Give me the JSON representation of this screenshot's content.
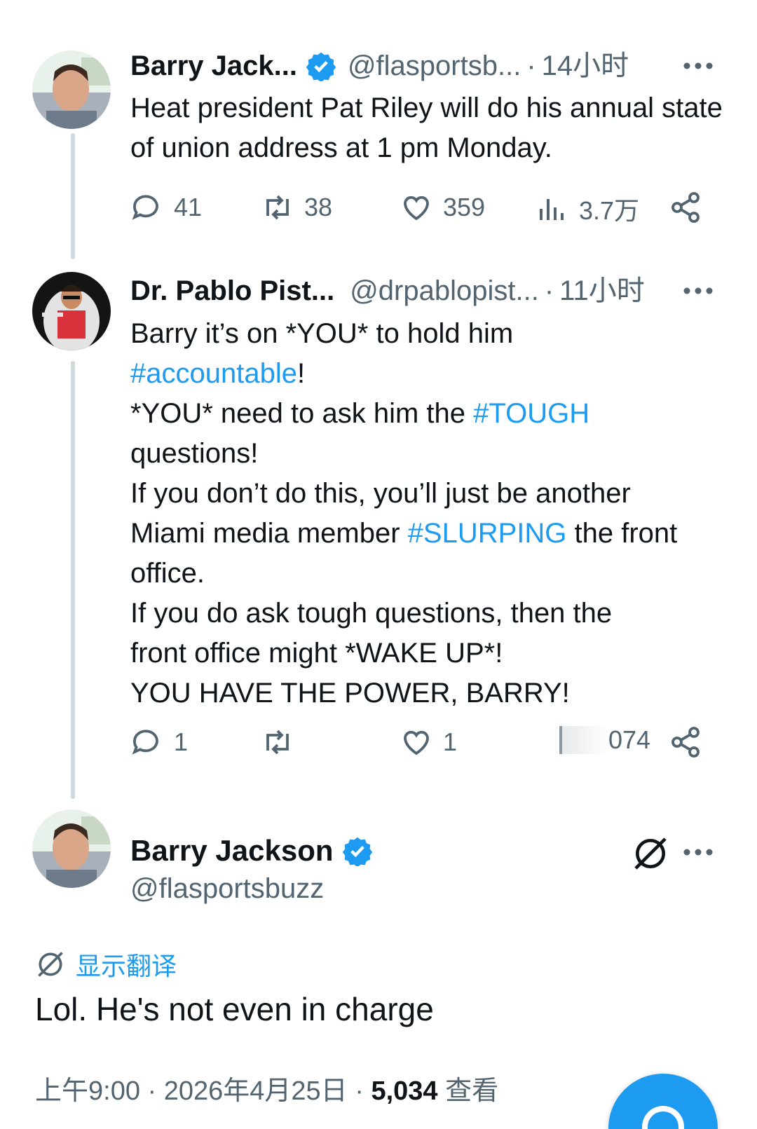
{
  "tweet1": {
    "name": "Barry Jack...",
    "handle": "@flasportsb...",
    "dot": "·",
    "time": "14小时",
    "text": "Heat president Pat Riley will do his annual state of union address at 1 pm Monday.",
    "replies": "41",
    "retweets": "38",
    "likes": "359",
    "views": "3.7万"
  },
  "tweet2": {
    "name": "Dr. Pablo Pist...",
    "handle": "@drpablopist...",
    "dot": "·",
    "time": "11小时",
    "text_parts": {
      "l1": "Barry it’s on *YOU* to hold him",
      "tag1": "#accountable",
      "l2_end": "!",
      "l3": "*YOU* need to ask him the ",
      "tag2": "#TOUGH",
      "l4": "questions!",
      "l5": "If you don’t do this, you’ll just be another",
      "l6": "Miami media member ",
      "tag3": "#SLURPING",
      "l6_end": " the front",
      "l7": "office.",
      "l8": "If you do ask tough questions, then the",
      "l9": "front office might *WAKE UP*!",
      "l10": "YOU HAVE THE POWER, BARRY!"
    },
    "replies": "1",
    "likes": "1",
    "views_partial": "074"
  },
  "main_tweet": {
    "name": "Barry Jackson",
    "handle": "@flasportsbuzz",
    "translate_label": "显示翻译",
    "text": "Lol. He's not even in charge",
    "time": "上午9:00",
    "sep": "·",
    "date": "2026年4月25日",
    "views_count": "5,034",
    "views_label": "查看"
  },
  "colors": {
    "accent": "#1d9bf0",
    "secondary_text": "#536471",
    "thread_line": "#cfd9de"
  },
  "icons": [
    "reply-icon",
    "retweet-icon",
    "like-icon",
    "views-icon",
    "share-icon",
    "more-icon",
    "verified-icon",
    "translate-icon",
    "grok-icon",
    "compose-icon"
  ]
}
